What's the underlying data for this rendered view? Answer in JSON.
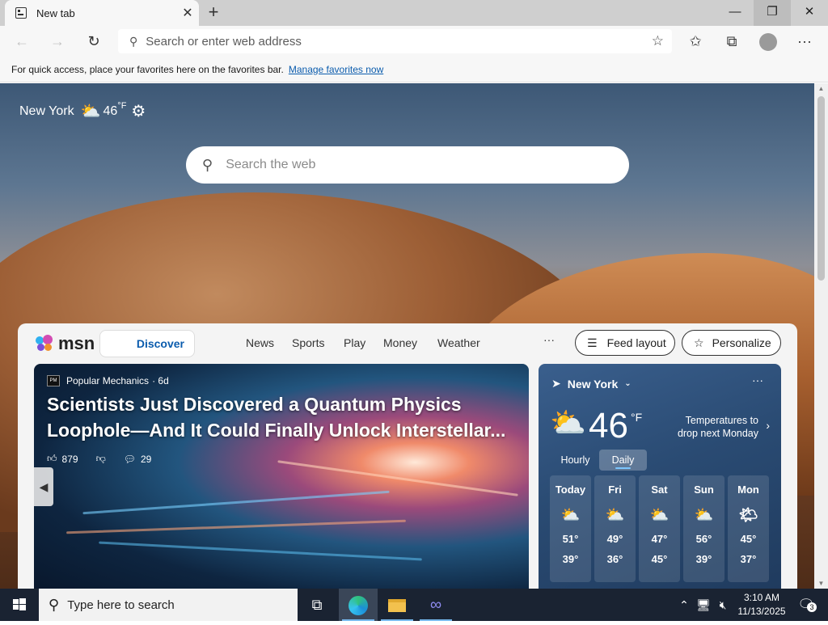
{
  "browser": {
    "tab_title": "New tab",
    "address_placeholder": "Search or enter web address"
  },
  "favorites_bar": {
    "message": "For quick access, place your favorites here on the favorites bar.",
    "link": "Manage favorites now"
  },
  "newtab": {
    "weather_widget": {
      "city": "New York",
      "temp": "46",
      "unit": "°F"
    },
    "search_placeholder": "Search the web"
  },
  "msn": {
    "logo": "msn",
    "nav": [
      "Discover",
      "News",
      "Sports",
      "Play",
      "Money",
      "Weather"
    ],
    "more": "···",
    "feed_layout": "Feed layout",
    "personalize": "Personalize"
  },
  "hero": {
    "source": "Popular Mechanics",
    "age": "· 6d",
    "headline": "Scientists Just Discovered a Quantum Physics Loophole—And It Could Finally Unlock Interstellar...",
    "likes": "879",
    "comments": "29"
  },
  "weather_card": {
    "location": "New York",
    "temp": "46",
    "unit": "°F",
    "alert": "Temperatures to drop next Monday",
    "tabs": [
      "Hourly",
      "Daily"
    ],
    "active_tab": "Daily",
    "days": [
      {
        "name": "Today",
        "high": "51°",
        "low": "39°",
        "icon": "partly-cloudy-icon"
      },
      {
        "name": "Fri",
        "high": "49°",
        "low": "36°",
        "icon": "partly-cloudy-icon"
      },
      {
        "name": "Sat",
        "high": "47°",
        "low": "45°",
        "icon": "partly-cloudy-icon"
      },
      {
        "name": "Sun",
        "high": "56°",
        "low": "39°",
        "icon": "partly-cloudy-icon"
      },
      {
        "name": "Mon",
        "high": "45°",
        "low": "37°",
        "icon": "mostly-sunny-icon"
      }
    ]
  },
  "taskbar": {
    "search_placeholder": "Type here to search",
    "time": "3:10 AM",
    "date": "11/13/2025",
    "notification_count": "3"
  }
}
